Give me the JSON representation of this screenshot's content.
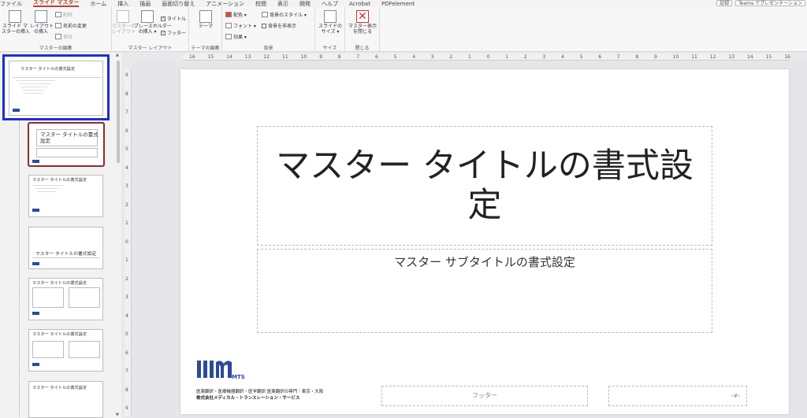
{
  "menubar": {
    "tabs": [
      "ファイル",
      "スライド マスター",
      "ホーム",
      "挿入",
      "描画",
      "画面切り替え",
      "アニメーション",
      "校閲",
      "表示",
      "開発",
      "ヘルプ",
      "Acrobat",
      "PDFelement"
    ],
    "record": "記録",
    "teams": "Teams でプレゼンテーション"
  },
  "ribbon": {
    "insert_slide_master": "スライド マ\nスターの挿入",
    "insert_layout": "レイアウト\nの挿入",
    "delete": "削除",
    "rename": "名前の変更",
    "preserve": "保持",
    "group_master_edit": "マスターの編集",
    "master_layout": "マスターの\nレイアウト",
    "insert_placeholder": "プレースホルダー\nの挿入 ▾",
    "title_check": "タイトル",
    "footer_check": "フッター",
    "group_master_layout": "マスター レイアウト",
    "themes": "テーマ",
    "group_edit_theme": "テーマの編集",
    "colors": "配色 ▾",
    "fonts": "フォント ▾",
    "effects": "効果 ▾",
    "bg_styles": "背景のスタイル ▾",
    "hide_bg": "背景を非表示",
    "group_background": "背景",
    "slide_size": "スライドの\nサイズ ▾",
    "group_size": "サイズ",
    "close_master": "マスター表示\nを閉じる",
    "group_close": "閉じる"
  },
  "ruler_h": [
    "16",
    "15",
    "14",
    "13",
    "12",
    "11",
    "10",
    "9",
    "8",
    "7",
    "6",
    "5",
    "4",
    "3",
    "2",
    "1",
    "0",
    "1",
    "2",
    "3",
    "4",
    "5",
    "6",
    "7",
    "8",
    "9",
    "10",
    "11",
    "12",
    "13",
    "14",
    "15",
    "16"
  ],
  "ruler_v": [
    "9",
    "8",
    "7",
    "6",
    "5",
    "4",
    "3",
    "2",
    "1",
    "0",
    "1",
    "2",
    "3",
    "4",
    "5",
    "6",
    "7",
    "8",
    "9"
  ],
  "thumbs": {
    "master_title": "マスター タイトルの書式設定",
    "t1_title": "マスター タイトルの書式\n設定",
    "t2_title": "マスター タイトルの書式設定",
    "t3_title": "マスター タイトルの書式設定",
    "t4_title": "マスター タイトルの書式設定",
    "t5_title": "マスター タイトルの書式設定",
    "t6_title": "マスター タイトルの書式設定"
  },
  "slide": {
    "title": "マスター タイトルの書式設定",
    "subtitle": "マスター サブタイトルの書式設定",
    "footer": "フッター",
    "page_number": "‹#›",
    "logo_line1": "医薬翻訳・医療機器翻訳・医学翻訳 医薬翻訳の専門｜東京・大阪",
    "logo_line2": "株式会社メディカル・トランスレーション・サービス",
    "logo_mark": "MTS"
  },
  "colors": {
    "accent": "#b7472a",
    "selection_blue": "#1a2fd4",
    "logo_blue": "#2c4a9c"
  }
}
